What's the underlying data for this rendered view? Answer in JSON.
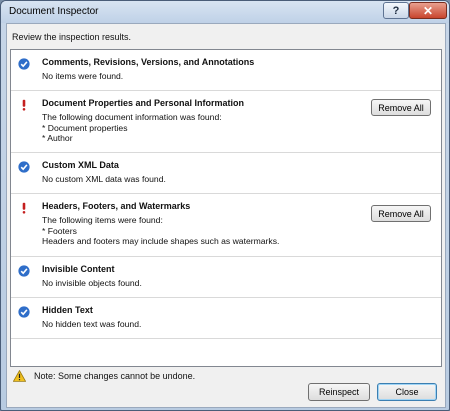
{
  "window": {
    "title": "Document Inspector",
    "help_glyph": "?",
    "close_glyph": "✕"
  },
  "instruction": "Review the inspection results.",
  "results": [
    {
      "status": "ok",
      "icon": "checkmark-icon",
      "heading": "Comments, Revisions, Versions, and Annotations",
      "lines": [
        "No items were found."
      ]
    },
    {
      "status": "found",
      "icon": "exclamation-icon",
      "heading": "Document Properties and Personal Information",
      "lines": [
        "The following document information was found:",
        "* Document properties",
        "* Author"
      ],
      "button": "Remove All"
    },
    {
      "status": "ok",
      "icon": "checkmark-icon",
      "heading": "Custom XML Data",
      "lines": [
        "No custom XML data was found."
      ]
    },
    {
      "status": "found",
      "icon": "exclamation-icon",
      "heading": "Headers, Footers, and Watermarks",
      "lines": [
        "The following items were found:",
        "* Footers",
        "Headers and footers may include shapes such as watermarks."
      ],
      "button": "Remove All"
    },
    {
      "status": "ok",
      "icon": "checkmark-icon",
      "heading": "Invisible Content",
      "lines": [
        "No invisible objects found."
      ]
    },
    {
      "status": "ok",
      "icon": "checkmark-icon",
      "heading": "Hidden Text",
      "lines": [
        "No hidden text was found."
      ]
    }
  ],
  "note": "Note: Some changes cannot be undone.",
  "buttons": {
    "reinspect": "Reinspect",
    "close": "Close"
  },
  "colors": {
    "ok_icon": "#2f6ec9",
    "warning_icon": "#c41f1f",
    "note_icon": "#f0c020"
  }
}
